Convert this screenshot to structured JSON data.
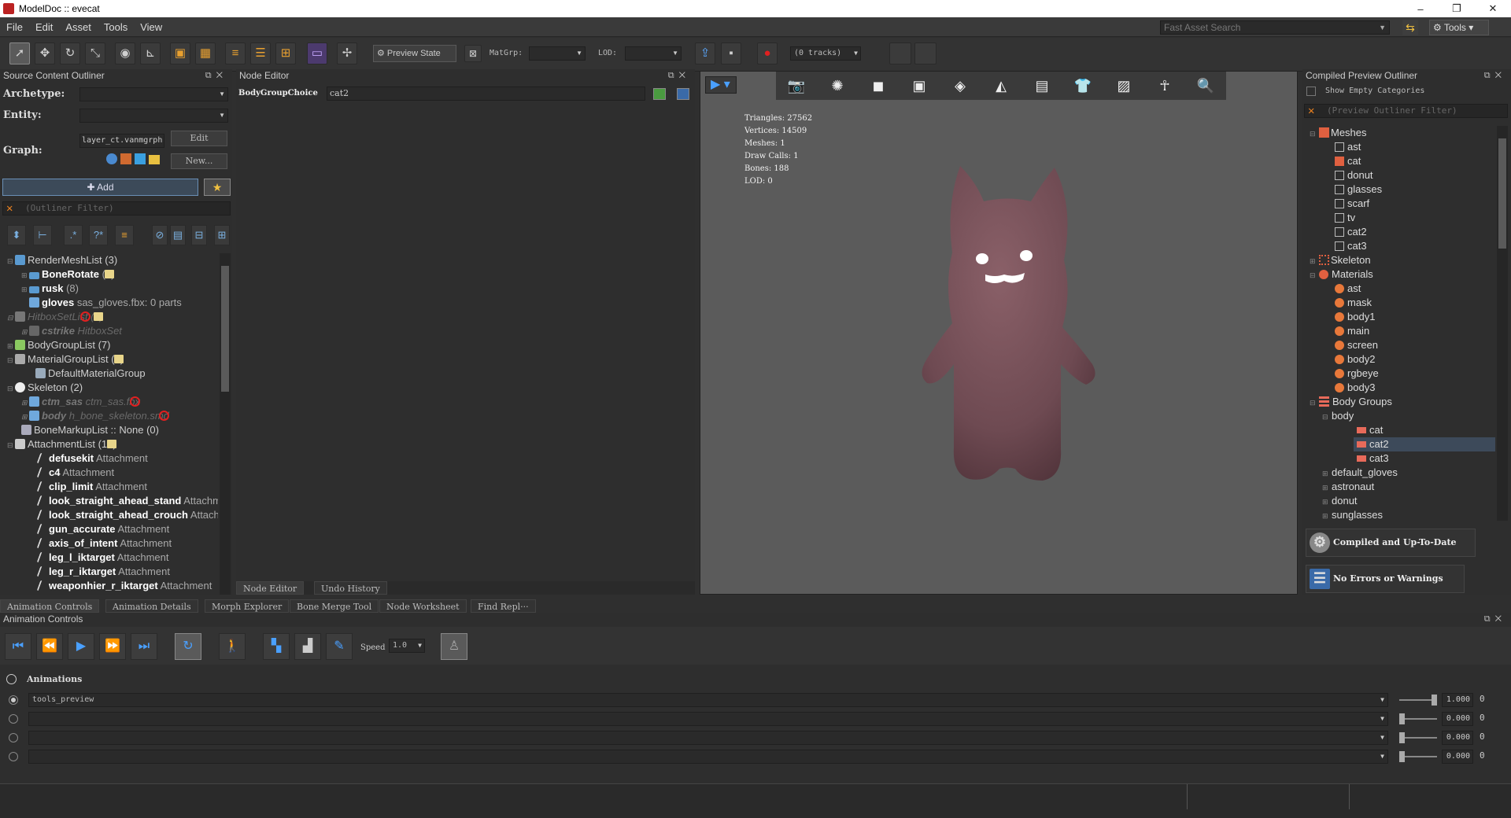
{
  "window": {
    "title": "ModelDoc :: evecat",
    "minimize": "–",
    "maximize": "❐",
    "close": "✕"
  },
  "menu": [
    "File",
    "Edit",
    "Asset",
    "Tools",
    "View"
  ],
  "fast_search": {
    "placeholder": "Fast Asset Search"
  },
  "tools_menu": {
    "label": "⚙ Tools ▾"
  },
  "toolbar": {
    "preview_state": "⚙ Preview State",
    "matgrp_label": "MatGrp:",
    "matgrp_value": "",
    "lod_label": "LOD:",
    "lod_value": "",
    "tracks": "(0 tracks)"
  },
  "sco": {
    "title": "Source Content Outliner",
    "archetype_label": "Archetype:",
    "entity_label": "Entity:",
    "graph_label": "Graph:",
    "graph_value": "layer_ct.vanmgrph",
    "edit_button": "Edit",
    "new_button": "New...",
    "add_button": "✚ Add",
    "filter_placeholder": "(Outliner Filter)",
    "tree": [
      {
        "text": "RenderMeshList (3)",
        "sub": "",
        "bold": false
      },
      {
        "text": "BoneRotate",
        "sub": "(4)",
        "bold": true
      },
      {
        "text": "rusk",
        "sub": "(8)",
        "bold": true
      },
      {
        "text": "gloves",
        "sub": "sas_gloves.fbx: 0 parts",
        "bold": true
      },
      {
        "text": "HitboxSetList (1)",
        "sub": "",
        "bold": false
      },
      {
        "text": "cstrike",
        "sub": "HitboxSet",
        "bold": true
      },
      {
        "text": "BodyGroupList (7)",
        "sub": "",
        "bold": false
      },
      {
        "text": "MaterialGroupList (1)",
        "sub": "",
        "bold": false
      },
      {
        "text": "DefaultMaterialGroup",
        "sub": "",
        "bold": false
      },
      {
        "text": "Skeleton (2)",
        "sub": "",
        "bold": false
      },
      {
        "text": "ctm_sas",
        "sub": "ctm_sas.fbx",
        "bold": true
      },
      {
        "text": "body",
        "sub": "h_bone_skeleton.smd",
        "bold": true
      },
      {
        "text": "BoneMarkupList :: None (0)",
        "sub": "",
        "bold": false
      },
      {
        "text": "AttachmentList (18)",
        "sub": "",
        "bold": false
      },
      {
        "text": "defusekit",
        "sub": "Attachment",
        "bold": true
      },
      {
        "text": "c4",
        "sub": "Attachment",
        "bold": true
      },
      {
        "text": "clip_limit",
        "sub": "Attachment",
        "bold": true
      },
      {
        "text": "look_straight_ahead_stand",
        "sub": "Attachment",
        "bold": true
      },
      {
        "text": "look_straight_ahead_crouch",
        "sub": "Attachme",
        "bold": true
      },
      {
        "text": "gun_accurate",
        "sub": "Attachment",
        "bold": true
      },
      {
        "text": "axis_of_intent",
        "sub": "Attachment",
        "bold": true
      },
      {
        "text": "leg_l_iktarget",
        "sub": "Attachment",
        "bold": true
      },
      {
        "text": "leg_r_iktarget",
        "sub": "Attachment",
        "bold": true
      },
      {
        "text": "weaponhier_r_iktarget",
        "sub": "Attachment",
        "bold": true
      }
    ]
  },
  "node_editor": {
    "title": "Node Editor",
    "field_label": "BodyGroupChoice",
    "field_value": "cat2",
    "tab_node_editor": "Node Editor",
    "tab_undo_history": "Undo History"
  },
  "viewport": {
    "stats": {
      "triangles": "Triangles: 27562",
      "vertices": "Vertices: 14509",
      "meshes": "Meshes: 1",
      "draw_calls": "Draw Calls: 1",
      "bones": "Bones: 188",
      "lod": "LOD: 0"
    },
    "model_color": "#6e4a52"
  },
  "cpo": {
    "title": "Compiled Preview Outliner",
    "show_empty": "Show Empty Categories",
    "filter_placeholder": "(Preview Outliner Filter)",
    "meshes_label": "Meshes",
    "meshes": [
      "ast",
      "cat",
      "donut",
      "glasses",
      "scarf",
      "tv",
      "cat2",
      "cat3"
    ],
    "skeleton_label": "Skeleton",
    "materials_label": "Materials",
    "materials": [
      "ast",
      "mask",
      "body1",
      "main",
      "screen",
      "body2",
      "rgbeye",
      "body3"
    ],
    "body_groups_label": "Body Groups",
    "body_label": "body",
    "body_choices": [
      "cat",
      "cat2",
      "cat3"
    ],
    "other_groups": [
      "default_gloves",
      "astronaut",
      "donut",
      "sunglasses"
    ],
    "status_compiled": "Compiled and Up-To-Date",
    "status_errors": "No Errors or Warnings"
  },
  "bottom_tabs": [
    "Animation Controls",
    "Animation Details",
    "Morph Explorer",
    "Bone Merge Tool",
    "Node Worksheet",
    "Find  Repl···"
  ],
  "anim": {
    "title": "Animation Controls",
    "speed_label": "Speed",
    "speed_value": "1.0",
    "animations_label": "Animations",
    "rows": [
      {
        "name": "tools_preview",
        "value": "1.000",
        "zero": "0",
        "level": 1.0,
        "selected": true
      },
      {
        "name": "",
        "value": "0.000",
        "zero": "0",
        "level": 0.0,
        "selected": false
      },
      {
        "name": "",
        "value": "0.000",
        "zero": "0",
        "level": 0.0,
        "selected": false
      },
      {
        "name": "",
        "value": "0.000",
        "zero": "0",
        "level": 0.0,
        "selected": false
      }
    ]
  }
}
